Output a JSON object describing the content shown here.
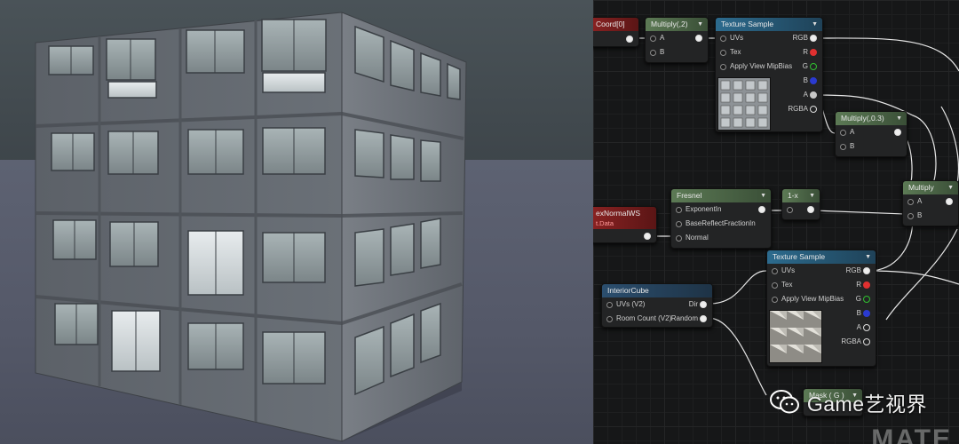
{
  "graph": {
    "nodes": {
      "texcoord": {
        "title": "Coord[0]"
      },
      "multiply2": {
        "title": "Multiply(,2)",
        "pins": {
          "a": "A",
          "b": "B"
        }
      },
      "texsample1": {
        "title": "Texture Sample",
        "inputs": [
          "UVs",
          "Tex",
          "Apply View MipBias"
        ],
        "outputs": [
          "RGB",
          "R",
          "G",
          "B",
          "A",
          "RGBA"
        ]
      },
      "multiply03": {
        "title": "Multiply(,0.3)",
        "pins": {
          "a": "A",
          "b": "B"
        }
      },
      "multiply": {
        "title": "Multiply",
        "pins": {
          "a": "A",
          "b": "B"
        }
      },
      "vertexnormal": {
        "title": "exNormalWS",
        "subtitle": "t.Data"
      },
      "fresnel": {
        "title": "Fresnel",
        "inputs": [
          "ExponentIn",
          "BaseReflectFractionIn",
          "Normal"
        ]
      },
      "oneminus": {
        "title": "1-x"
      },
      "texsample2": {
        "title": "Texture Sample",
        "inputs": [
          "UVs",
          "Tex",
          "Apply View MipBias"
        ],
        "outputs": [
          "RGB",
          "R",
          "G",
          "B",
          "A",
          "RGBA"
        ]
      },
      "interiorcube": {
        "title": "InteriorCube",
        "inputs": [
          "UVs (V2)",
          "Room Count (V2)"
        ],
        "outputs": [
          "Dir",
          "Random"
        ]
      },
      "mask": {
        "title": "Mask ( G )"
      }
    },
    "pin_colors": {
      "r": "#e03030",
      "g": "#30c030",
      "b": "#2a3ad0",
      "a": "#c8c8c8",
      "white": "#eeeeee"
    },
    "watermark": "Game艺视界",
    "bottom_mark": "MATE"
  }
}
